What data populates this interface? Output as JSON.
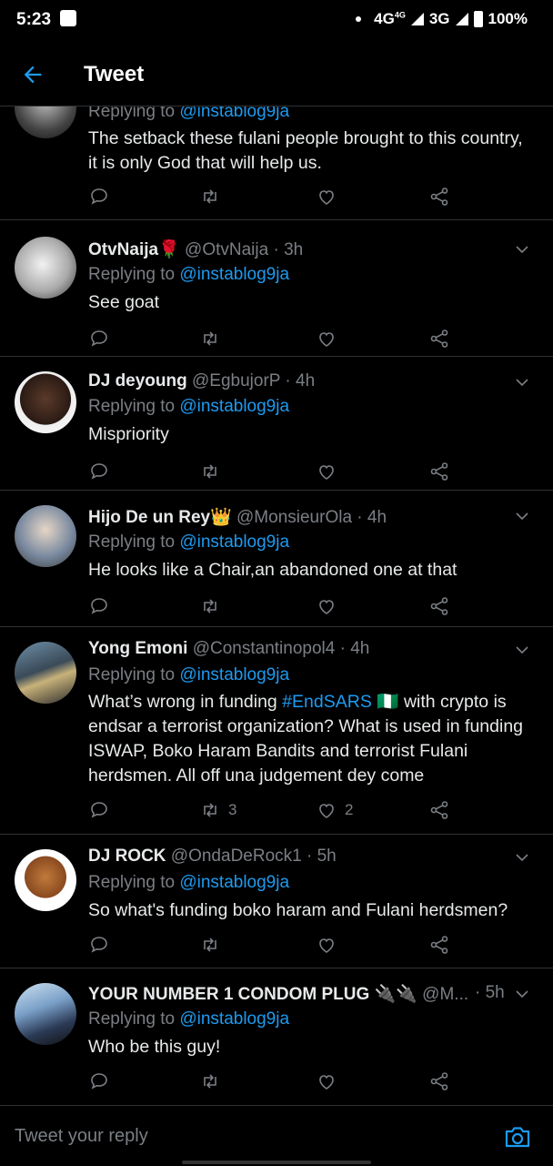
{
  "status_bar": {
    "time": "5:23",
    "network_1": "4G",
    "network_1_sup": "4G",
    "network_2": "3G",
    "battery": "100%"
  },
  "header": {
    "title": "Tweet"
  },
  "reply_prefix": "Replying to",
  "tweets": [
    {
      "name": "",
      "handle": "",
      "time": "",
      "replying_to": "@instablog9ja",
      "text": "The setback these fulani people brought to this country, it is only God that will help us.",
      "retweets": "",
      "likes": ""
    },
    {
      "name": "OtvNaija🌹",
      "handle": "@OtvNaija",
      "time": "· 3h",
      "replying_to": "@instablog9ja",
      "text": "See goat",
      "retweets": "",
      "likes": ""
    },
    {
      "name": "DJ deyoung",
      "handle": "@EgbujorP",
      "time": "· 4h",
      "replying_to": "@instablog9ja",
      "text": "Mispriority",
      "retweets": "",
      "likes": ""
    },
    {
      "name": "Hijo De un Rey👑",
      "handle": "@MonsieurOla",
      "time": "· 4h",
      "replying_to": "@instablog9ja",
      "text": "He looks  like a Chair,an abandoned one at that",
      "retweets": "",
      "likes": ""
    },
    {
      "name": "Yong Emoni",
      "handle": "@Constantinopol4",
      "time": "· 4h",
      "replying_to": "@instablog9ja",
      "text_before": "What’s wrong in funding ",
      "hashtag": "#EndSARS",
      "text_after": " 🇳🇬  with crypto is endsar a terrorist organization? What is used in funding ISWAP, Boko Haram Bandits and terrorist Fulani herdsmen. All off una judgement dey come",
      "retweets": "3",
      "likes": "2"
    },
    {
      "name": "DJ ROCK",
      "handle": "@OndaDeRock1",
      "time": "· 5h",
      "replying_to": "@instablog9ja",
      "text": "So what's funding boko haram and Fulani herdsmen?",
      "retweets": "",
      "likes": ""
    },
    {
      "name": "YOUR NUMBER 1 CONDOM PLUG 🔌🔌",
      "handle": "@M...",
      "time": "· 5h",
      "replying_to": "@instablog9ja",
      "text": "Who be this guy!",
      "retweets": "",
      "likes": ""
    }
  ],
  "reply_bar": {
    "placeholder": "Tweet your reply"
  },
  "icons": {
    "back": "arrow-left-icon",
    "reply": "comment-icon",
    "retweet": "retweet-icon",
    "like": "heart-icon",
    "share": "share-icon",
    "more": "chevron-down-icon",
    "camera": "camera-icon"
  },
  "colors": {
    "accent": "#1d9bf0",
    "background": "#000000",
    "muted": "#7b7f84"
  }
}
